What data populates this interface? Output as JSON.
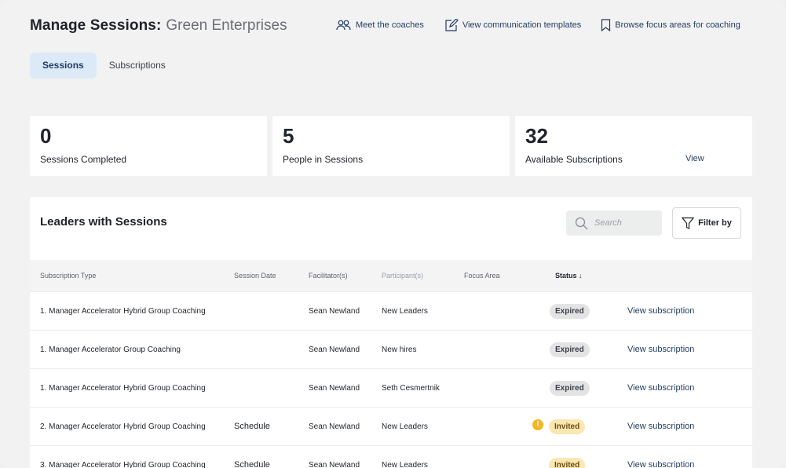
{
  "header": {
    "title": "Manage Sessions:",
    "org": "Green Enterprises",
    "links": [
      {
        "label": "Meet the coaches",
        "icon": "people-icon"
      },
      {
        "label": "View communication templates",
        "icon": "edit-icon"
      },
      {
        "label": "Browse focus areas for coaching",
        "icon": "bookmark-icon"
      }
    ]
  },
  "tabs": [
    {
      "label": "Sessions",
      "active": true
    },
    {
      "label": "Subscriptions",
      "active": false
    }
  ],
  "stats": [
    {
      "value": "0",
      "label": "Sessions Completed"
    },
    {
      "value": "5",
      "label": "People in Sessions"
    },
    {
      "value": "32",
      "label": "Available Subscriptions",
      "link": "View"
    }
  ],
  "table": {
    "title": "Leaders with Sessions",
    "search_placeholder": "Search",
    "filter_label": "Filter by",
    "columns": {
      "subscription_type": "Subscription Type",
      "session_date": "Session Date",
      "facilitators": "Facilitator(s)",
      "participants": "Participant(s)",
      "focus_area": "Focus Area",
      "status": "Status ↓"
    },
    "rows": [
      {
        "type": "1. Manager Accelerator Hybrid Group Coaching",
        "date": "",
        "facilitator": "Sean Newland",
        "participant": "New Leaders",
        "focus": "",
        "status": "Expired",
        "link": "View subscription"
      },
      {
        "type": "1. Manager Accelerator Group Coaching",
        "date": "",
        "facilitator": "Sean Newland",
        "participant": "New hires",
        "focus": "",
        "status": "Expired",
        "link": "View subscription"
      },
      {
        "type": "1. Manager Accelerator Hybrid Group Coaching",
        "date": "",
        "facilitator": "Sean Newland",
        "participant": "Seth Cesmertnik",
        "focus": "",
        "status": "Expired",
        "link": "View subscription"
      },
      {
        "type": "2. Manager Accelerator Hybrid Group Coaching",
        "date": "Schedule",
        "facilitator": "Sean Newland",
        "participant": "New Leaders",
        "focus": "",
        "status": "Invited",
        "warning": "!",
        "link": "View subscription"
      },
      {
        "type": "3. Manager Accelerator Hybrid Group Coaching",
        "date": "Schedule",
        "facilitator": "Sean Newland",
        "participant": "New Leaders",
        "focus": "",
        "status": "Invited",
        "link": "View subscription"
      }
    ]
  },
  "colors": {
    "accent": "#1f3a5f",
    "tab_active_bg": "#dce9f7",
    "expired_bg": "#e3e3e4",
    "invited_bg": "#fbe7b2",
    "warning": "#f4b526"
  }
}
